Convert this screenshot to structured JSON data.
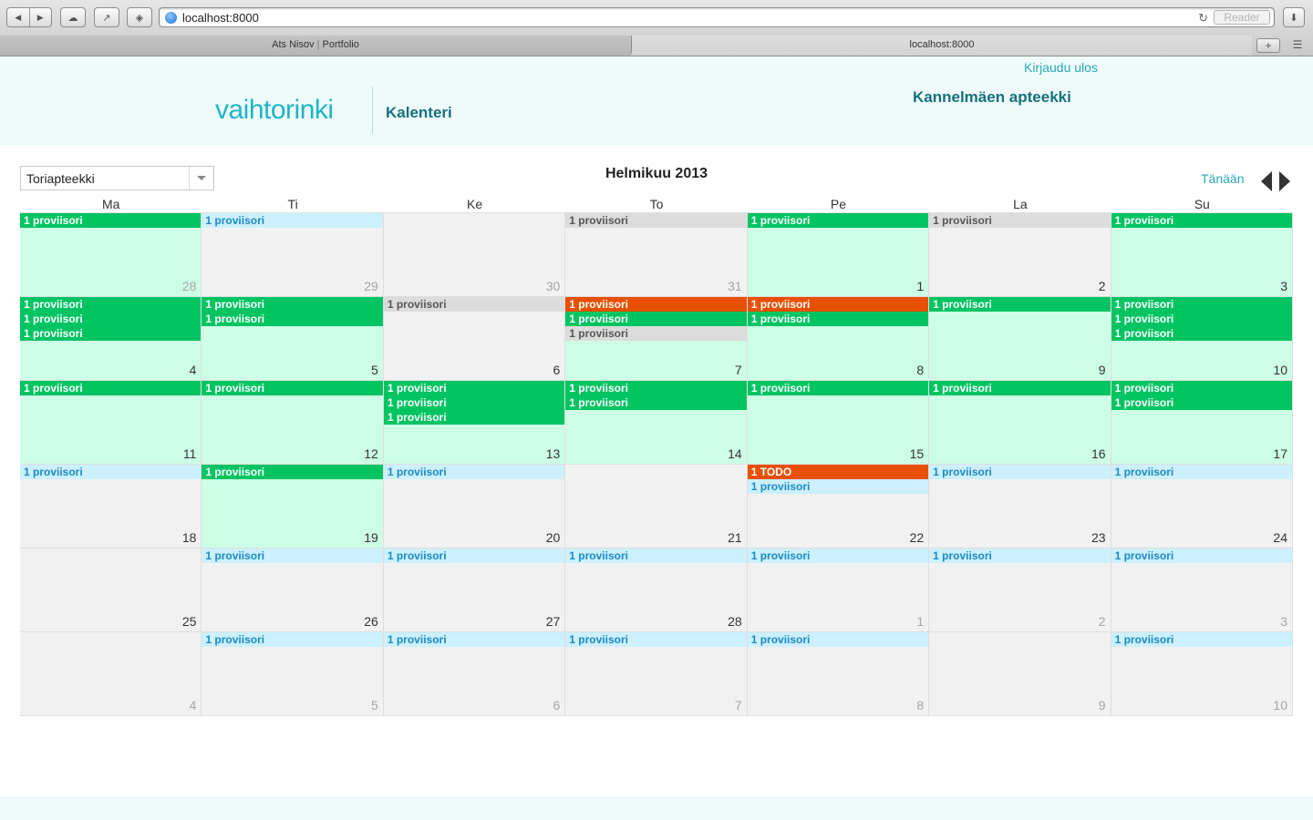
{
  "browser": {
    "url": "localhost:8000",
    "reader_label": "Reader",
    "tabs": [
      {
        "label_left": "Ats Nisov",
        "label_right": "Portfolio"
      },
      {
        "label": "localhost:8000"
      }
    ],
    "new_tab_glyph": "+",
    "tab_list_glyph": "☰"
  },
  "header": {
    "logout": "Kirjaudu ulos",
    "logo": "vaihtorinki",
    "page_title": "Kalenteri",
    "pharmacy": "Kannelmäen apteekki"
  },
  "controls": {
    "select_value": "Toriapteekki",
    "month_title": "Helmikuu 2013",
    "today": "Tänään"
  },
  "colors": {
    "green": "#00c462",
    "orange": "#e85000",
    "grey": "#dcdcdc",
    "blue": "#ccf0fd",
    "filled_day": "#ccffe6",
    "empty_day": "#f1f1f1",
    "accent": "#2aa6b8"
  },
  "calendar": {
    "weekdays": [
      "Ma",
      "Ti",
      "Ke",
      "To",
      "Pe",
      "La",
      "Su"
    ],
    "weeks": [
      [
        {
          "day": "28",
          "other": true,
          "filled": true,
          "events": [
            {
              "type": "green",
              "label": "1 proviisori"
            }
          ]
        },
        {
          "day": "29",
          "other": true,
          "filled": false,
          "events": [
            {
              "type": "blue",
              "label": "1 proviisori"
            }
          ]
        },
        {
          "day": "30",
          "other": true,
          "filled": false,
          "events": []
        },
        {
          "day": "31",
          "other": true,
          "filled": false,
          "events": [
            {
              "type": "grey",
              "label": "1 proviisori"
            }
          ]
        },
        {
          "day": "1",
          "other": false,
          "filled": true,
          "events": [
            {
              "type": "green",
              "label": "1 proviisori"
            }
          ]
        },
        {
          "day": "2",
          "other": false,
          "filled": false,
          "events": [
            {
              "type": "grey",
              "label": "1 proviisori"
            }
          ]
        },
        {
          "day": "3",
          "other": false,
          "filled": true,
          "events": [
            {
              "type": "green",
              "label": "1 proviisori"
            }
          ]
        }
      ],
      [
        {
          "day": "4",
          "other": false,
          "filled": true,
          "events": [
            {
              "type": "green",
              "label": "1 proviisori"
            },
            {
              "type": "green",
              "label": "1 proviisori"
            },
            {
              "type": "green",
              "label": "1 proviisori"
            }
          ]
        },
        {
          "day": "5",
          "other": false,
          "filled": true,
          "events": [
            {
              "type": "green",
              "label": "1 proviisori"
            },
            {
              "type": "green",
              "label": "1 proviisori"
            }
          ]
        },
        {
          "day": "6",
          "other": false,
          "filled": false,
          "events": [
            {
              "type": "grey",
              "label": "1 proviisori"
            }
          ]
        },
        {
          "day": "7",
          "other": false,
          "filled": true,
          "events": [
            {
              "type": "orange",
              "label": "1 proviisori"
            },
            {
              "type": "green",
              "label": "1 proviisori"
            },
            {
              "type": "grey",
              "label": "1 proviisori"
            }
          ]
        },
        {
          "day": "8",
          "other": false,
          "filled": true,
          "events": [
            {
              "type": "orange",
              "label": "1 proviisori"
            },
            {
              "type": "green",
              "label": "1 proviisori"
            }
          ]
        },
        {
          "day": "9",
          "other": false,
          "filled": true,
          "events": [
            {
              "type": "green",
              "label": "1 proviisori"
            }
          ]
        },
        {
          "day": "10",
          "other": false,
          "filled": true,
          "events": [
            {
              "type": "green",
              "label": "1 proviisori"
            },
            {
              "type": "green",
              "label": "1 proviisori"
            },
            {
              "type": "green",
              "label": "1 proviisori"
            }
          ]
        }
      ],
      [
        {
          "day": "11",
          "other": false,
          "filled": true,
          "events": [
            {
              "type": "green",
              "label": "1 proviisori"
            }
          ]
        },
        {
          "day": "12",
          "other": false,
          "filled": true,
          "events": [
            {
              "type": "green",
              "label": "1 proviisori"
            }
          ]
        },
        {
          "day": "13",
          "other": false,
          "filled": true,
          "events": [
            {
              "type": "green",
              "label": "1 proviisori"
            },
            {
              "type": "green",
              "label": "1 proviisori"
            },
            {
              "type": "green",
              "label": "1 proviisori"
            }
          ]
        },
        {
          "day": "14",
          "other": false,
          "filled": true,
          "events": [
            {
              "type": "green",
              "label": "1 proviisori"
            },
            {
              "type": "green",
              "label": "1 proviisori"
            }
          ]
        },
        {
          "day": "15",
          "other": false,
          "filled": true,
          "events": [
            {
              "type": "green",
              "label": "1 proviisori"
            }
          ]
        },
        {
          "day": "16",
          "other": false,
          "filled": true,
          "events": [
            {
              "type": "green",
              "label": "1 proviisori"
            }
          ]
        },
        {
          "day": "17",
          "other": false,
          "filled": true,
          "events": [
            {
              "type": "green",
              "label": "1 proviisori"
            },
            {
              "type": "green",
              "label": "1 proviisori"
            }
          ]
        }
      ],
      [
        {
          "day": "18",
          "other": false,
          "filled": false,
          "events": [
            {
              "type": "blue",
              "label": "1 proviisori"
            }
          ]
        },
        {
          "day": "19",
          "other": false,
          "filled": true,
          "events": [
            {
              "type": "green",
              "label": "1 proviisori"
            }
          ]
        },
        {
          "day": "20",
          "other": false,
          "filled": false,
          "events": [
            {
              "type": "blue",
              "label": "1 proviisori"
            }
          ]
        },
        {
          "day": "21",
          "other": false,
          "filled": false,
          "events": []
        },
        {
          "day": "22",
          "other": false,
          "filled": false,
          "events": [
            {
              "type": "orange",
              "label": "1 TODO"
            },
            {
              "type": "blue",
              "label": "1 proviisori"
            }
          ]
        },
        {
          "day": "23",
          "other": false,
          "filled": false,
          "events": [
            {
              "type": "blue",
              "label": "1 proviisori"
            }
          ]
        },
        {
          "day": "24",
          "other": false,
          "filled": false,
          "events": [
            {
              "type": "blue",
              "label": "1 proviisori"
            }
          ]
        }
      ],
      [
        {
          "day": "25",
          "other": false,
          "filled": false,
          "events": []
        },
        {
          "day": "26",
          "other": false,
          "filled": false,
          "events": [
            {
              "type": "blue",
              "label": "1 proviisori"
            }
          ]
        },
        {
          "day": "27",
          "other": false,
          "filled": false,
          "events": [
            {
              "type": "blue",
              "label": "1 proviisori"
            }
          ]
        },
        {
          "day": "28",
          "other": false,
          "filled": false,
          "events": [
            {
              "type": "blue",
              "label": "1 proviisori"
            }
          ]
        },
        {
          "day": "1",
          "other": true,
          "filled": false,
          "events": [
            {
              "type": "blue",
              "label": "1 proviisori"
            }
          ]
        },
        {
          "day": "2",
          "other": true,
          "filled": false,
          "events": [
            {
              "type": "blue",
              "label": "1 proviisori"
            }
          ]
        },
        {
          "day": "3",
          "other": true,
          "filled": false,
          "events": [
            {
              "type": "blue",
              "label": "1 proviisori"
            }
          ]
        }
      ],
      [
        {
          "day": "4",
          "other": true,
          "filled": false,
          "events": []
        },
        {
          "day": "5",
          "other": true,
          "filled": false,
          "events": [
            {
              "type": "blue",
              "label": "1 proviisori"
            }
          ]
        },
        {
          "day": "6",
          "other": true,
          "filled": false,
          "events": [
            {
              "type": "blue",
              "label": "1 proviisori"
            }
          ]
        },
        {
          "day": "7",
          "other": true,
          "filled": false,
          "events": [
            {
              "type": "blue",
              "label": "1 proviisori"
            }
          ]
        },
        {
          "day": "8",
          "other": true,
          "filled": false,
          "events": [
            {
              "type": "blue",
              "label": "1 proviisori"
            }
          ]
        },
        {
          "day": "9",
          "other": true,
          "filled": false,
          "events": []
        },
        {
          "day": "10",
          "other": true,
          "filled": false,
          "events": [
            {
              "type": "blue",
              "label": "1 proviisori"
            }
          ]
        }
      ]
    ]
  }
}
